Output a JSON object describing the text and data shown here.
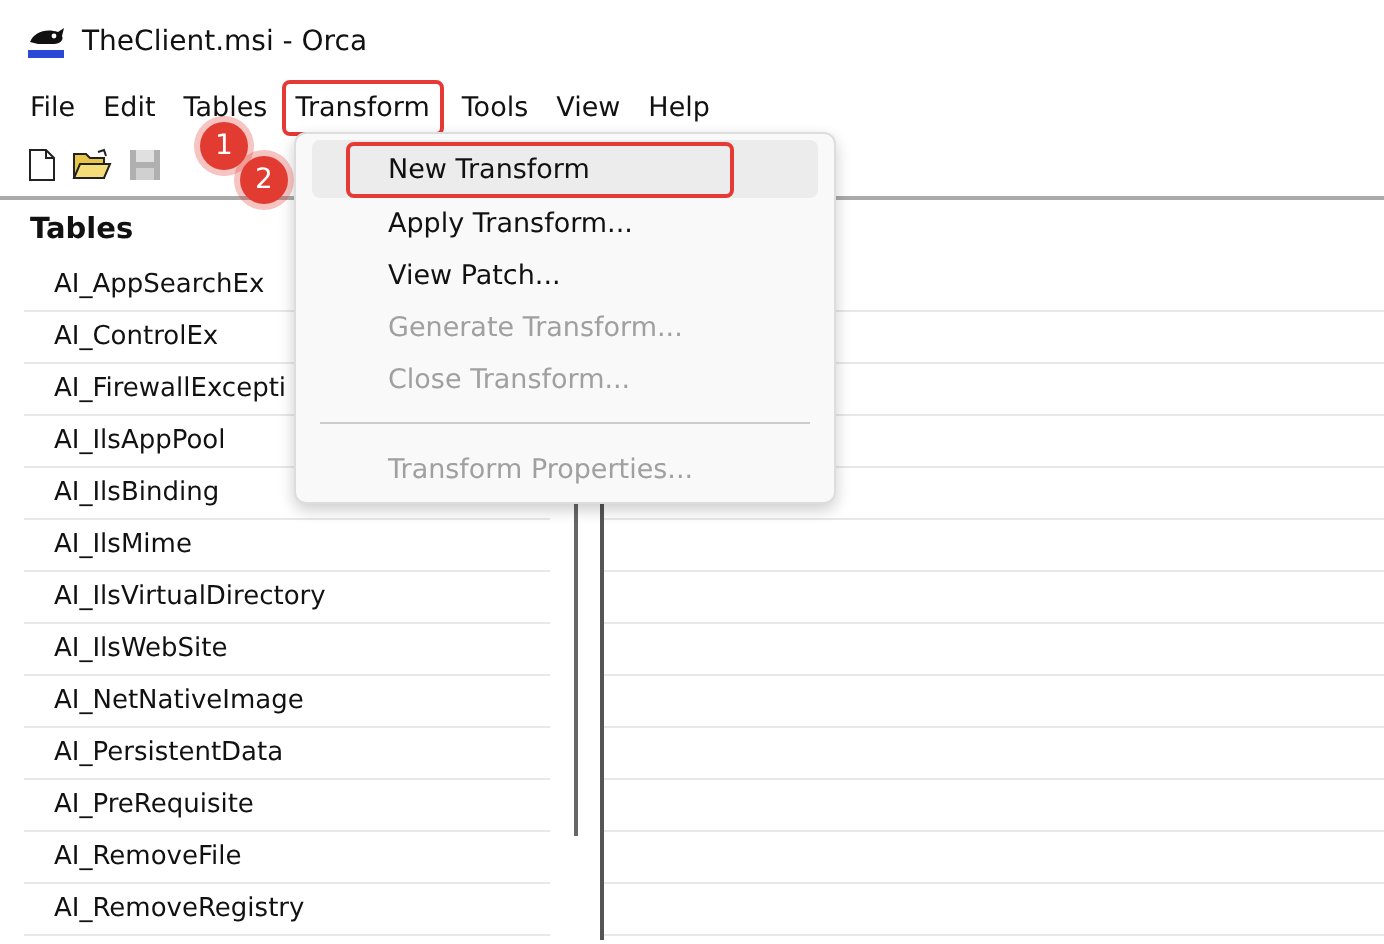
{
  "window": {
    "title": "TheClient.msi - Orca"
  },
  "menu_bar": [
    {
      "label": "File",
      "callout": false
    },
    {
      "label": "Edit",
      "callout": false
    },
    {
      "label": "Tables",
      "callout": false
    },
    {
      "label": "Transform",
      "callout": true
    },
    {
      "label": "Tools",
      "callout": false
    },
    {
      "label": "View",
      "callout": false
    },
    {
      "label": "Help",
      "callout": false
    }
  ],
  "toolbar": [
    {
      "kind": "new",
      "disabled": false
    },
    {
      "kind": "open",
      "disabled": false
    },
    {
      "kind": "save",
      "disabled": true
    }
  ],
  "tables_pane": {
    "heading": "Tables",
    "items": [
      "AI_AppSearchEx",
      "AI_ControlEx",
      "AI_FirewallExcepti",
      "AI_IlsAppPool",
      "AI_IlsBinding",
      "AI_IlsMime",
      "AI_IlsVirtualDirectory",
      "AI_IlsWebSite",
      "AI_NetNativeImage",
      "AI_PersistentData",
      "AI_PreRequisite",
      "AI_RemoveFile",
      "AI_RemoveRegistry"
    ]
  },
  "transform_menu": [
    {
      "kind": "item",
      "label": "New Transform",
      "selected": true,
      "disabled": false,
      "callout": true
    },
    {
      "kind": "item",
      "label": "Apply Transform...",
      "selected": false,
      "disabled": false,
      "callout": false
    },
    {
      "kind": "item",
      "label": "View Patch...",
      "selected": false,
      "disabled": false,
      "callout": false
    },
    {
      "kind": "item",
      "label": "Generate Transform...",
      "selected": false,
      "disabled": true,
      "callout": false
    },
    {
      "kind": "item",
      "label": "Close Transform...",
      "selected": false,
      "disabled": true,
      "callout": false
    },
    {
      "kind": "separator"
    },
    {
      "kind": "item",
      "label": "Transform Properties...",
      "selected": false,
      "disabled": true,
      "callout": false
    }
  ],
  "step_badges": [
    "1",
    "2"
  ]
}
